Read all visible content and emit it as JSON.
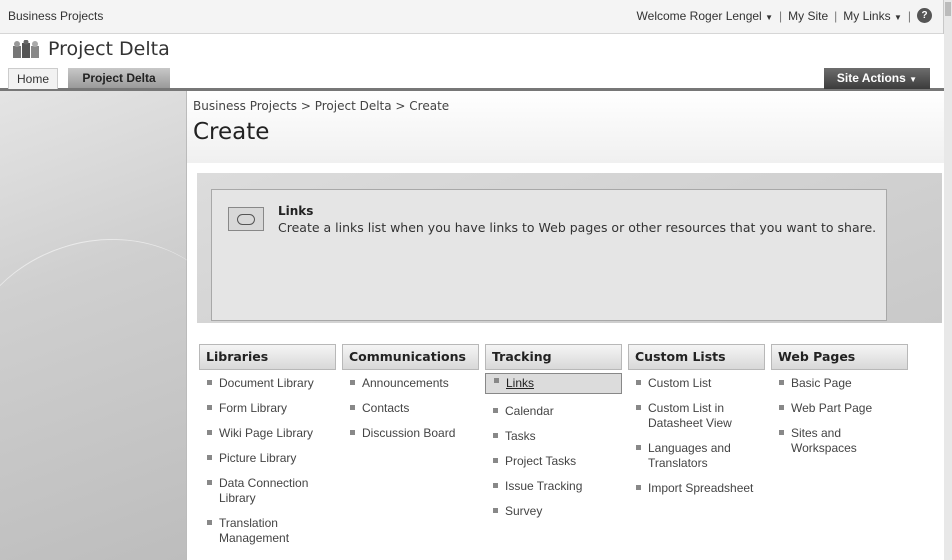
{
  "topbar": {
    "site_name": "Business Projects",
    "welcome": "Welcome Roger Lengel",
    "my_site": "My Site",
    "my_links": "My Links",
    "separator": "|"
  },
  "title_area": {
    "site_title": "Project Delta"
  },
  "tabs": [
    {
      "label": "Home",
      "active": false
    },
    {
      "label": "Project Delta",
      "active": true
    }
  ],
  "site_actions": {
    "label": "Site Actions"
  },
  "breadcrumb": "Business Projects > Project Delta > Create",
  "page_title": "Create",
  "info": {
    "title": "Links",
    "description": "Create a links list when you have links to Web pages or other resources that you want to share."
  },
  "columns": [
    {
      "heading": "Libraries",
      "items": [
        "Document Library",
        "Form Library",
        "Wiki Page Library",
        "Picture Library",
        "Data Connection Library",
        "Translation Management"
      ]
    },
    {
      "heading": "Communications",
      "items": [
        "Announcements",
        "Contacts",
        "Discussion Board"
      ]
    },
    {
      "heading": "Tracking",
      "items": [
        "Links",
        "Calendar",
        "Tasks",
        "Project Tasks",
        "Issue Tracking",
        "Survey"
      ],
      "selected": "Links"
    },
    {
      "heading": "Custom Lists",
      "items": [
        "Custom List",
        "Custom List in Datasheet View",
        "Languages and Translators",
        "Import Spreadsheet"
      ]
    },
    {
      "heading": "Web Pages",
      "items": [
        "Basic Page",
        "Web Part Page",
        "Sites and Workspaces"
      ]
    }
  ],
  "icons": {
    "help": "help-icon",
    "logo": "site-logo-icon",
    "links": "links-list-icon",
    "dropdown": "chevron-down-icon"
  },
  "colors": {
    "site_actions_bg": "#4a4a4a",
    "active_tab_bg": "#a8a8a8",
    "selected_item_bg": "#dcdcdc"
  }
}
